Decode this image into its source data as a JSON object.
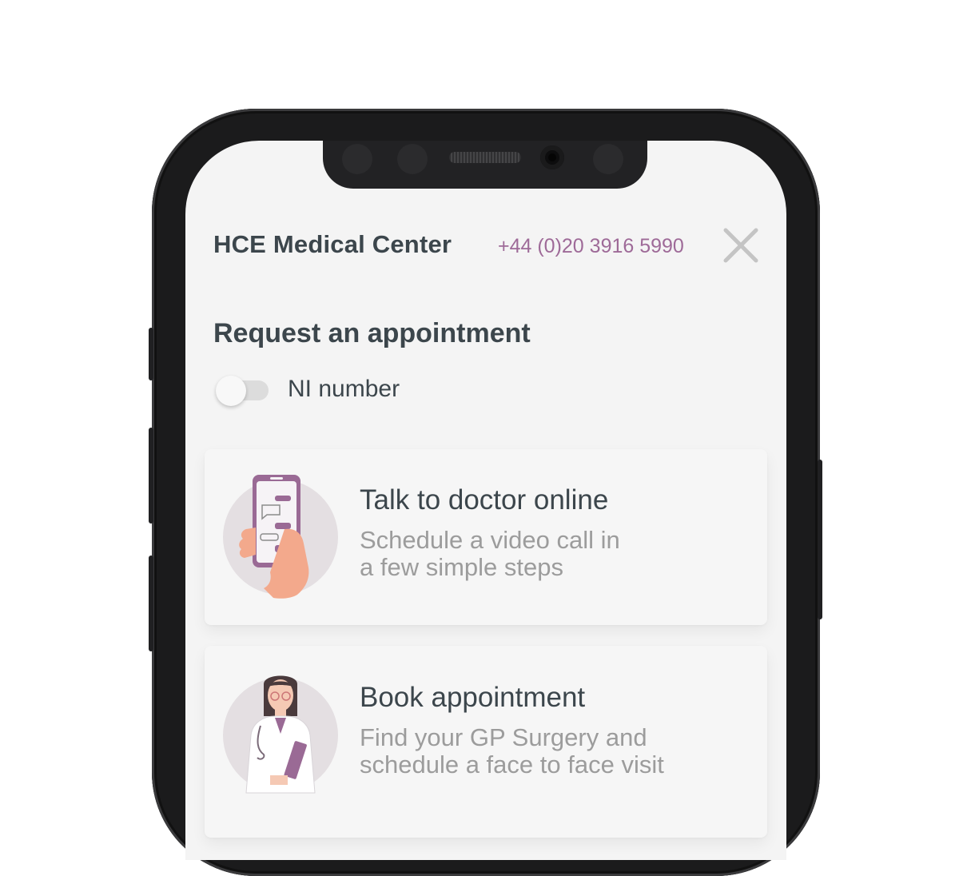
{
  "header": {
    "title": "HCE Medical Center",
    "phone": "+44 (0)20 3916 5990"
  },
  "appointment": {
    "section_title": "Request an appointment",
    "toggle_label": "NI number",
    "toggle_on": false
  },
  "cards": [
    {
      "title": "Talk to doctor online",
      "subtitle_line1": "Schedule a video call in",
      "subtitle_line2": "a few simple steps",
      "icon": "phone-chat-icon"
    },
    {
      "title": "Book appointment",
      "subtitle_line1": "Find your GP Surgery and",
      "subtitle_line2": "schedule a face to face visit",
      "icon": "doctor-icon"
    }
  ],
  "colors": {
    "accent": "#9e6a98",
    "text": "#3c464c",
    "muted": "#9c9c9c",
    "background": "#f4f4f4"
  }
}
